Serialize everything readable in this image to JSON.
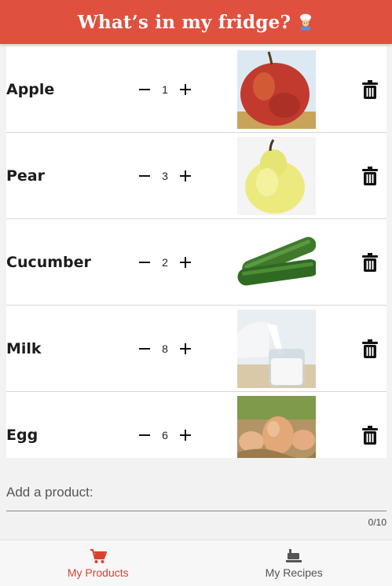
{
  "header": {
    "title": "What’s in my fridge?",
    "title_icon": "chef-icon"
  },
  "colors": {
    "accent": "#e0503f",
    "active_nav": "#d9432f"
  },
  "products": [
    {
      "name": "Apple",
      "quantity": "1",
      "image": "apple"
    },
    {
      "name": "Pear",
      "quantity": "3",
      "image": "pear"
    },
    {
      "name": "Cucumber",
      "quantity": "2",
      "image": "cucumber"
    },
    {
      "name": "Milk",
      "quantity": "8",
      "image": "milk"
    },
    {
      "name": "Egg",
      "quantity": "6",
      "image": "egg"
    }
  ],
  "add_product": {
    "placeholder": "Add a product:",
    "value": "",
    "counter": "0/10"
  },
  "nav": {
    "products": {
      "label": "My Products",
      "icon": "cart-icon",
      "active": true
    },
    "recipes": {
      "label": "My Recipes",
      "icon": "cooking-pot-icon",
      "active": false
    }
  }
}
